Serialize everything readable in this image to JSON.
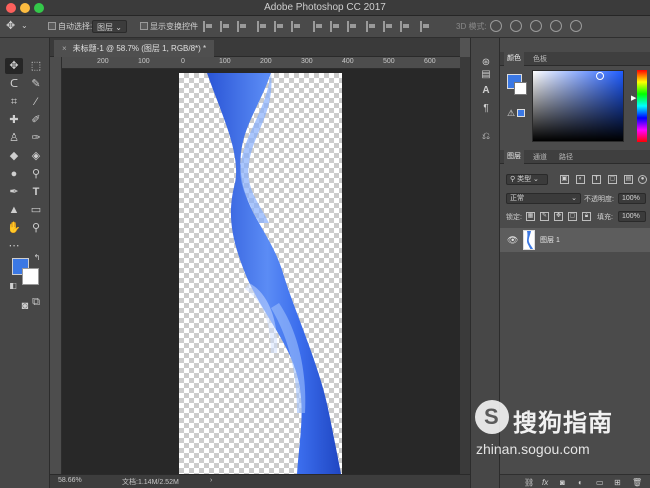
{
  "window": {
    "title": "Adobe Photoshop CC 2017"
  },
  "options_bar": {
    "auto_select_label": "自动选择:",
    "auto_select_target": "图层",
    "show_transform_label": "显示变换控件",
    "mode_3d": "3D 模式:"
  },
  "document": {
    "tab_title": "未标题-1 @ 58.7% (图层 1, RGB/8*) *",
    "close_glyph": "×"
  },
  "ruler": {
    "labels": [
      "200",
      "100",
      "0",
      "100",
      "200",
      "300",
      "400",
      "500",
      "600"
    ]
  },
  "status": {
    "zoom": "58.66%",
    "doc_info": "文档:1.14M/2.52M",
    "arrow": "›"
  },
  "panels": {
    "color_tabs": [
      "颜色",
      "色板"
    ],
    "layer_tabs": [
      "图层",
      "通道",
      "路径"
    ],
    "filter_kind": "类型",
    "blend_mode": "正常",
    "opacity_label": "不透明度:",
    "opacity_value": "100%",
    "lock_label": "锁定:",
    "fill_label": "填充:",
    "fill_value": "100%",
    "layer_name": "图层 1",
    "bottom_icons": [
      "fx"
    ]
  },
  "colors": {
    "foreground": "#3b78e4",
    "background": "#ffffff",
    "accent": "#3b78e4"
  },
  "watermark": {
    "logo_letter": "S",
    "brand": "搜狗指南",
    "url": "zhinan.sogou.com"
  }
}
